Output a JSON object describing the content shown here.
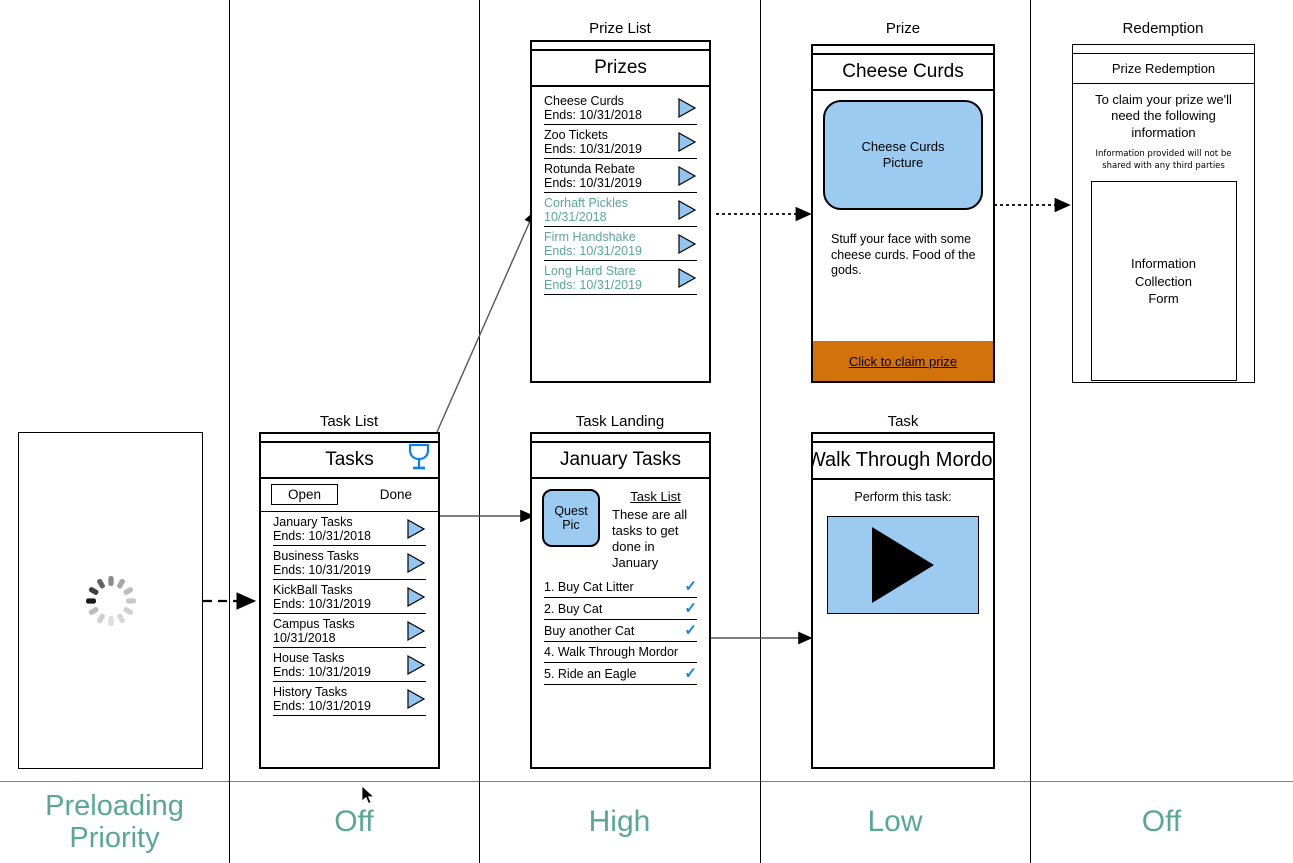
{
  "panels": {
    "loading": {
      "title": "",
      "spinner_icon": "loading-spinner-icon"
    },
    "task_list": {
      "title": "Task List",
      "header": "Tasks",
      "trophy_icon": "trophy-icon",
      "tabs": [
        {
          "label": "Open",
          "selected": true
        },
        {
          "label": "Done",
          "selected": false
        }
      ],
      "items": [
        {
          "name": "January Tasks",
          "date": "Ends: 10/31/2018",
          "teal": false
        },
        {
          "name": "Business Tasks",
          "date": "Ends: 10/31/2019",
          "teal": false
        },
        {
          "name": "KickBall Tasks",
          "date": "Ends: 10/31/2019",
          "teal": false
        },
        {
          "name": "Campus Tasks",
          "date": "10/31/2018",
          "teal": false
        },
        {
          "name": "House Tasks",
          "date": "Ends: 10/31/2019",
          "teal": false
        },
        {
          "name": "History Tasks",
          "date": "Ends: 10/31/2019",
          "teal": false
        }
      ]
    },
    "prize_list": {
      "title": "Prize List",
      "header": "Prizes",
      "items": [
        {
          "name": "Cheese Curds",
          "date": "Ends: 10/31/2018",
          "teal": false
        },
        {
          "name": "Zoo Tickets",
          "date": "Ends: 10/31/2019",
          "teal": false
        },
        {
          "name": "Rotunda Rebate",
          "date": "Ends: 10/31/2019",
          "teal": false
        },
        {
          "name": "Corhaft Pickles",
          "date": "10/31/2018",
          "teal": true
        },
        {
          "name": "Firm Handshake",
          "date": "Ends: 10/31/2019",
          "teal": true
        },
        {
          "name": "Long Hard Stare",
          "date": "Ends: 10/31/2019",
          "teal": true
        }
      ]
    },
    "prize": {
      "title": "Prize",
      "header": "Cheese Curds",
      "picture_caption_line1": "Cheese Curds",
      "picture_caption_line2": "Picture",
      "description": "Stuff your face with some cheese curds. Food of the gods.",
      "claim_label": "Click to claim prize",
      "claim_color": "#d2720a"
    },
    "redemption": {
      "title": "Redemption",
      "header": "Prize Redemption",
      "lead": "To claim your prize we'll need the following information",
      "fine_print": "Information provided will not be shared with any third parties",
      "form_line1": "Information",
      "form_line2": "Collection",
      "form_line3": "Form"
    },
    "task_landing": {
      "title": "Task Landing",
      "header": "January Tasks",
      "quest_pic_line1": "Quest",
      "quest_pic_line2": "Pic",
      "section_heading": "Task List",
      "section_body": "These are all tasks to get done in January",
      "checks": [
        {
          "label": "1. Buy Cat Litter",
          "done": true
        },
        {
          "label": "2. Buy Cat",
          "done": true
        },
        {
          "label": "Buy another Cat",
          "done": true
        },
        {
          "label": "4. Walk Through Mordor",
          "done": false
        },
        {
          "label": "5. Ride an Eagle",
          "done": true
        }
      ]
    },
    "task": {
      "title": "Task",
      "header": "Walk Through Mordor",
      "subtitle": "Perform this task:",
      "play_icon": "play-button-icon"
    }
  },
  "priority_row": {
    "label": "Preloading Priority",
    "label_line1": "Preloading",
    "label_line2": "Priority",
    "accent_color": "#5aa795",
    "values": [
      "Off",
      "High",
      "Low",
      "Off"
    ]
  }
}
